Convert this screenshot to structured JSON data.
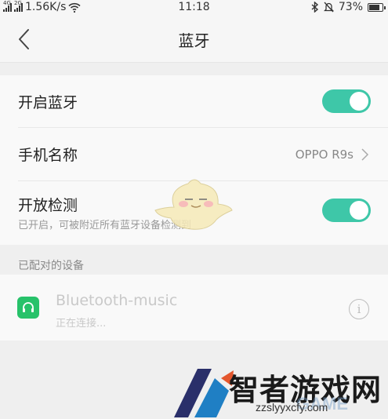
{
  "status_bar": {
    "net1": "4G",
    "net2": "2G",
    "speed": "1.56K/s",
    "time": "11:18",
    "battery": "73%",
    "icons": [
      "signal-icon",
      "signal-icon",
      "wifi-icon",
      "bluetooth-icon",
      "mute-bell-icon",
      "battery-icon"
    ]
  },
  "header": {
    "title": "蓝牙",
    "back_icon": "back-arrow-icon"
  },
  "settings": {
    "bluetooth_label": "开启蓝牙",
    "bluetooth_on": true,
    "phone_name_label": "手机名称",
    "phone_name_value": "OPPO R9s",
    "visible_label": "开放检测",
    "visible_sub": "已开启，可被附近所有蓝牙设备检测到",
    "visible_on": true
  },
  "paired": {
    "section_title": "已配对的设备",
    "devices": [
      {
        "name": "Bluetooth-music",
        "status": "正在连接...",
        "icon": "headset-icon"
      }
    ],
    "info_glyph": "i"
  },
  "watermark": {
    "brand": "智者游戏网",
    "url": "zzslyyxcfy.com",
    "game": "GAME"
  },
  "colors": {
    "accent": "#3ec7a8",
    "device_icon": "#27c26a",
    "background": "#efefef"
  }
}
